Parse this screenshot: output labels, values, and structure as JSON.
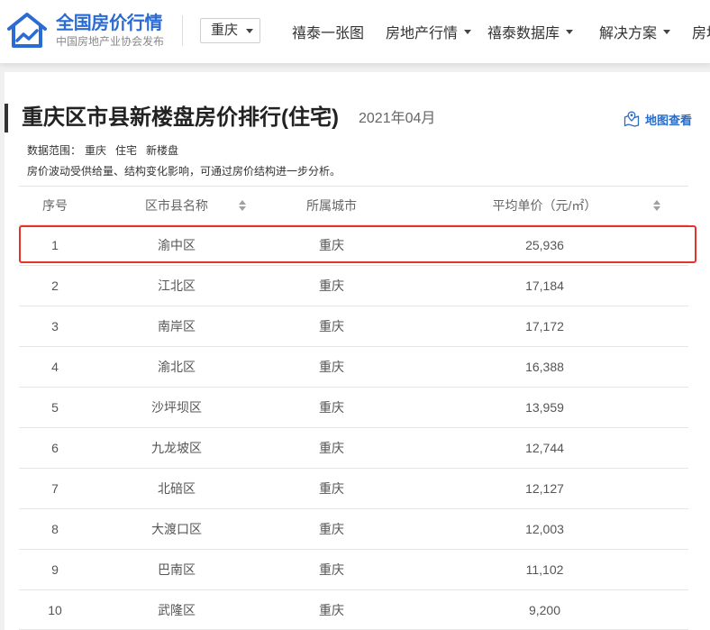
{
  "header": {
    "logo": {
      "title": "全国房价行情",
      "subtitle": "中国房地产业协会发布",
      "icon": "house-chart-icon"
    },
    "city_select": {
      "value": "重庆",
      "icon": "caret-down-icon"
    },
    "nav": [
      {
        "label": "禧泰一张图"
      },
      {
        "label": "房地产行情",
        "icon": "caret-down-icon"
      },
      {
        "label": "禧泰数据库",
        "icon": "caret-down-icon"
      },
      {
        "label": "解决方案",
        "icon": "caret-down-icon"
      },
      {
        "label": "房地"
      }
    ]
  },
  "report": {
    "title": "重庆区市县新楼盘房价排行(住宅)",
    "period": "2021年04月",
    "map_link": {
      "label": "地图查看",
      "icon": "map-pin-icon"
    },
    "scope": {
      "label": "数据范围：",
      "items": [
        "重庆",
        "住宅",
        "新楼盘"
      ]
    },
    "note": "房价波动受供给量、结构变化影响，可通过房价结构进一步分析。"
  },
  "table": {
    "columns": [
      {
        "label": "序号"
      },
      {
        "label": "区市县名称",
        "icon": "sort-icon"
      },
      {
        "label": "所属城市"
      },
      {
        "label": "平均单价（元/㎡）",
        "icon": "sort-icon"
      }
    ],
    "rows": [
      {
        "rank": "1",
        "district": "渝中区",
        "city": "重庆",
        "avg_price": "25,936",
        "highlighted": true
      },
      {
        "rank": "2",
        "district": "江北区",
        "city": "重庆",
        "avg_price": "17,184"
      },
      {
        "rank": "3",
        "district": "南岸区",
        "city": "重庆",
        "avg_price": "17,172"
      },
      {
        "rank": "4",
        "district": "渝北区",
        "city": "重庆",
        "avg_price": "16,388"
      },
      {
        "rank": "5",
        "district": "沙坪坝区",
        "city": "重庆",
        "avg_price": "13,959"
      },
      {
        "rank": "6",
        "district": "九龙坡区",
        "city": "重庆",
        "avg_price": "12,744"
      },
      {
        "rank": "7",
        "district": "北碚区",
        "city": "重庆",
        "avg_price": "12,127"
      },
      {
        "rank": "8",
        "district": "大渡口区",
        "city": "重庆",
        "avg_price": "12,003"
      },
      {
        "rank": "9",
        "district": "巴南区",
        "city": "重庆",
        "avg_price": "11,102"
      },
      {
        "rank": "10",
        "district": "武隆区",
        "city": "重庆",
        "avg_price": "9,200"
      }
    ]
  },
  "colors": {
    "brand_blue": "#2a6bd4",
    "link_blue": "#2b6cc4",
    "highlight_border": "#e5332a",
    "title_bar": "#333333",
    "page_background": "#f0f0f0"
  }
}
